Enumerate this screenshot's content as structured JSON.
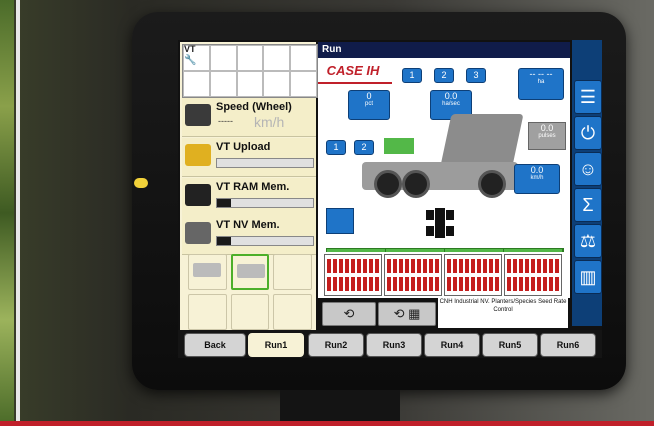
{
  "title": "Run",
  "brand": {
    "logo": "CASE IH",
    "accent": "#c0202a",
    "blue": "#1f74c8",
    "green": "#53b848"
  },
  "left_panel": {
    "vt_label": "VT",
    "speed": {
      "label": "Speed (Wheel)",
      "value": "-----",
      "unit": "km/h"
    },
    "upload": {
      "label": "VT Upload",
      "progress": 0
    },
    "ram": {
      "label": "VT RAM Mem.",
      "progress": 0.15
    },
    "nv": {
      "label": "VT NV Mem.",
      "progress": 0.15
    }
  },
  "main": {
    "top_buttons": [
      "1",
      "2",
      "3"
    ],
    "dash_box": {
      "value": "-- -- --",
      "unit": "ha"
    },
    "box_a": {
      "value": "0",
      "unit": "pct"
    },
    "box_b": {
      "value": "0.0",
      "unit": "ha/sec"
    },
    "gray_box": {
      "value": "0.0",
      "unit": "pulses"
    },
    "speed_box": {
      "value": "0.0",
      "unit": "km/h"
    },
    "seg_buttons": [
      "1",
      "2"
    ]
  },
  "controls": {
    "info_text": "CNH Industrial NV. Planters/Species Seed Rate Control"
  },
  "tabs": [
    {
      "label": "Back"
    },
    {
      "label": "Run1"
    },
    {
      "label": "Run2"
    },
    {
      "label": "Run3"
    },
    {
      "label": "Run4"
    },
    {
      "label": "Run5"
    },
    {
      "label": "Run6"
    }
  ],
  "rail_icons": [
    "menu-icon",
    "power-icon",
    "operator-icon",
    "sum-icon",
    "scale-icon",
    "chart-icon"
  ]
}
